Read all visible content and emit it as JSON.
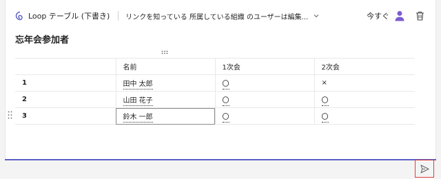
{
  "header": {
    "title": "Loop テーブル (下書き)",
    "permission": "リンクを知っている 所属している組織 のユーザーは編集...",
    "now_label": "今すぐ"
  },
  "page": {
    "title": "忘年会参加者"
  },
  "table": {
    "headers": [
      "",
      "名前",
      "1次会",
      "2次会"
    ],
    "rows": [
      [
        "1",
        "田中 太郎",
        "〇",
        "×"
      ],
      [
        "2",
        "山田 花子",
        "〇",
        "〇"
      ],
      [
        "3",
        "鈴木 一郎",
        "〇",
        "〇"
      ]
    ]
  },
  "colors": {
    "accent": "#5b5fc7",
    "loop": "#5b5fc7",
    "highlight": "#e23b3b"
  },
  "icons": {
    "loop": "loop-icon",
    "chevron": "chevron-down-icon",
    "person": "person-icon",
    "trash": "trash-icon",
    "send": "send-icon"
  }
}
